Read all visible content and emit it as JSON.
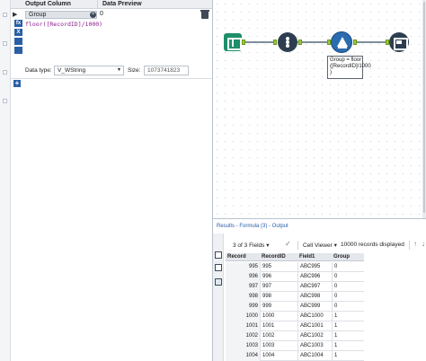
{
  "config": {
    "output_column_header": "Output Column",
    "data_preview_header": "Data Preview",
    "selected_column": "Group",
    "preview_value": "0",
    "expression": "floor([RecordID]/1000)",
    "data_type_label": "Data type:",
    "data_type_value": "V_WString",
    "size_label": "Size:",
    "size_value": "1073741823",
    "tools": [
      "fx",
      "X"
    ]
  },
  "canvas": {
    "annotation": "Group = floor\n([RecordID]/1000\n)"
  },
  "results": {
    "title": "Results - Formula (3) - Output",
    "fields_label": "3 of 3 Fields",
    "viewer_label": "Cell Viewer",
    "records_label": "10000 records displayed",
    "columns": [
      "Record",
      "RecordID",
      "Field1",
      "Group"
    ],
    "rows": [
      [
        "995",
        "995",
        "ABC995",
        "0"
      ],
      [
        "996",
        "996",
        "ABC996",
        "0"
      ],
      [
        "997",
        "997",
        "ABC997",
        "0"
      ],
      [
        "998",
        "998",
        "ABC998",
        "0"
      ],
      [
        "999",
        "999",
        "ABC999",
        "0"
      ],
      [
        "1000",
        "1000",
        "ABC1000",
        "1"
      ],
      [
        "1001",
        "1001",
        "ABC1001",
        "1"
      ],
      [
        "1002",
        "1002",
        "ABC1002",
        "1"
      ],
      [
        "1003",
        "1003",
        "ABC1003",
        "1"
      ],
      [
        "1004",
        "1004",
        "ABC1004",
        "1"
      ]
    ]
  }
}
